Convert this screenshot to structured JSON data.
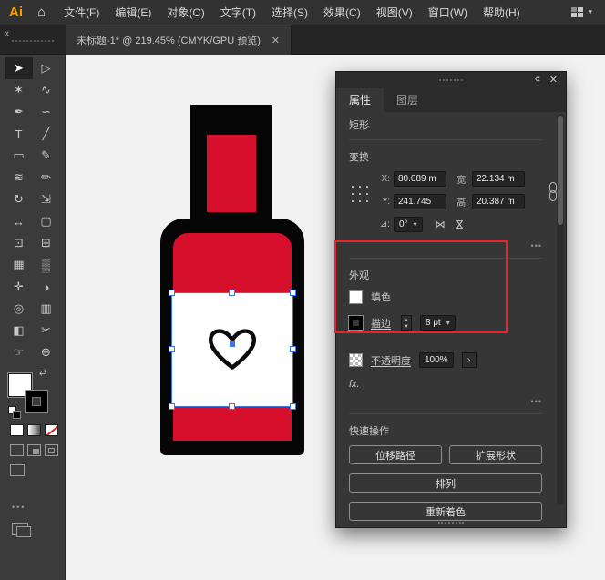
{
  "menubar": {
    "logo": "Ai",
    "items": [
      "文件(F)",
      "编辑(E)",
      "对象(O)",
      "文字(T)",
      "选择(S)",
      "效果(C)",
      "视图(V)",
      "窗口(W)",
      "帮助(H)"
    ]
  },
  "tabbar": {
    "title": "未标题-1* @ 219.45% (CMYK/GPU 预览)"
  },
  "icons": {
    "home": "⌂",
    "caret_down": "▾",
    "collapse_left": "«",
    "close": "✕",
    "swap": "⇄",
    "more": "•••",
    "stepper_up": "▴",
    "stepper_down": "▾",
    "chevron_right": "›",
    "flip": "⋈"
  },
  "toolbar": {
    "tools": [
      {
        "name": "selection",
        "glyph": "➤"
      },
      {
        "name": "direct-selection",
        "glyph": "▷"
      },
      {
        "name": "magic-wand",
        "glyph": "✶"
      },
      {
        "name": "lasso",
        "glyph": "∿"
      },
      {
        "name": "pen",
        "glyph": "✒"
      },
      {
        "name": "curvature",
        "glyph": "∽"
      },
      {
        "name": "type",
        "glyph": "T"
      },
      {
        "name": "line-segment",
        "glyph": "╱"
      },
      {
        "name": "rectangle",
        "glyph": "▭"
      },
      {
        "name": "paintbrush",
        "glyph": "✎"
      },
      {
        "name": "shaper",
        "glyph": "≋"
      },
      {
        "name": "pencil",
        "glyph": "✏"
      },
      {
        "name": "rotate",
        "glyph": "↻"
      },
      {
        "name": "scale",
        "glyph": "⇲"
      },
      {
        "name": "width",
        "glyph": "↔"
      },
      {
        "name": "free-transform",
        "glyph": "▢"
      },
      {
        "name": "shape-builder",
        "glyph": "⊡"
      },
      {
        "name": "perspective-grid",
        "glyph": "⊞"
      },
      {
        "name": "mesh",
        "glyph": "▦"
      },
      {
        "name": "gradient",
        "glyph": "▒"
      },
      {
        "name": "eyedropper",
        "glyph": "✛"
      },
      {
        "name": "blend",
        "glyph": "◑"
      },
      {
        "name": "symbol-sprayer",
        "glyph": "◎"
      },
      {
        "name": "column-graph",
        "glyph": "▥"
      },
      {
        "name": "artboard",
        "glyph": "◧"
      },
      {
        "name": "slice",
        "glyph": "✂"
      },
      {
        "name": "hand",
        "glyph": "☞"
      },
      {
        "name": "zoom",
        "glyph": "⊕"
      }
    ]
  },
  "panel": {
    "tabs": {
      "properties": "属性",
      "layers": "图层"
    },
    "object_type": "矩形",
    "transform": {
      "label": "变换",
      "x_label": "X:",
      "x_value": "80.089 m",
      "y_label": "Y:",
      "y_value": "241.745",
      "w_label": "宽:",
      "w_value": "22.134 m",
      "h_label": "高:",
      "h_value": "20.387 m",
      "angle_label": "⊿:",
      "angle_value": "0°"
    },
    "appearance": {
      "label": "外观",
      "fill_label": "填色",
      "stroke_label": "描边",
      "stroke_value": "8 pt",
      "opacity_label": "不透明度",
      "opacity_value": "100%",
      "fx_label": "fx."
    },
    "quick_actions": {
      "label": "快速操作",
      "offset_path": "位移路径",
      "expand_shape": "扩展形状",
      "arrange": "排列",
      "recolor": "重新着色"
    }
  },
  "colors": {
    "accent_blue": "#3778e8",
    "bottle_red": "#d60f2c",
    "annotation_red": "#e8252d",
    "logo_orange": "#ff9a00"
  }
}
